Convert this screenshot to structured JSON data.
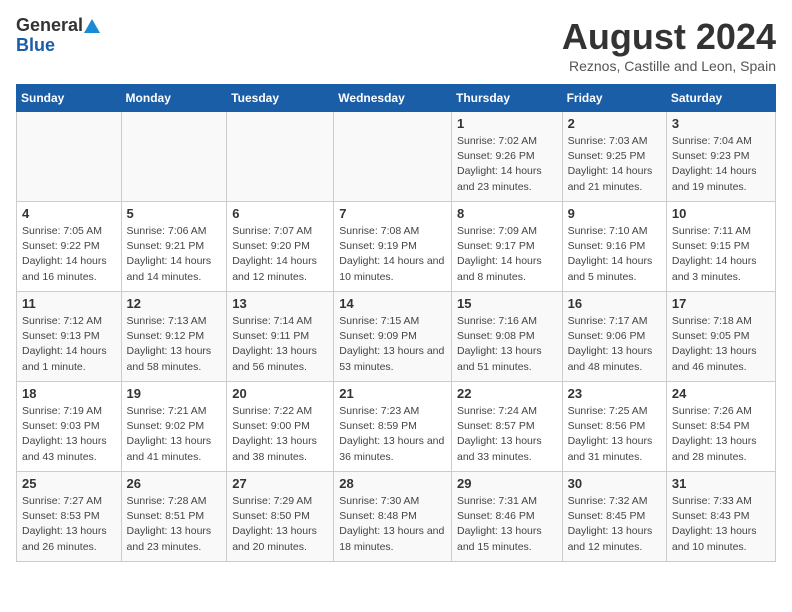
{
  "header": {
    "logo": {
      "line1": "General",
      "line2": "Blue"
    },
    "title": "August 2024",
    "location": "Reznos, Castille and Leon, Spain"
  },
  "days_of_week": [
    "Sunday",
    "Monday",
    "Tuesday",
    "Wednesday",
    "Thursday",
    "Friday",
    "Saturday"
  ],
  "weeks": [
    {
      "days": [
        {
          "number": "",
          "info": ""
        },
        {
          "number": "",
          "info": ""
        },
        {
          "number": "",
          "info": ""
        },
        {
          "number": "",
          "info": ""
        },
        {
          "number": "1",
          "info": "Sunrise: 7:02 AM\nSunset: 9:26 PM\nDaylight: 14 hours and 23 minutes."
        },
        {
          "number": "2",
          "info": "Sunrise: 7:03 AM\nSunset: 9:25 PM\nDaylight: 14 hours and 21 minutes."
        },
        {
          "number": "3",
          "info": "Sunrise: 7:04 AM\nSunset: 9:23 PM\nDaylight: 14 hours and 19 minutes."
        }
      ]
    },
    {
      "days": [
        {
          "number": "4",
          "info": "Sunrise: 7:05 AM\nSunset: 9:22 PM\nDaylight: 14 hours and 16 minutes."
        },
        {
          "number": "5",
          "info": "Sunrise: 7:06 AM\nSunset: 9:21 PM\nDaylight: 14 hours and 14 minutes."
        },
        {
          "number": "6",
          "info": "Sunrise: 7:07 AM\nSunset: 9:20 PM\nDaylight: 14 hours and 12 minutes."
        },
        {
          "number": "7",
          "info": "Sunrise: 7:08 AM\nSunset: 9:19 PM\nDaylight: 14 hours and 10 minutes."
        },
        {
          "number": "8",
          "info": "Sunrise: 7:09 AM\nSunset: 9:17 PM\nDaylight: 14 hours and 8 minutes."
        },
        {
          "number": "9",
          "info": "Sunrise: 7:10 AM\nSunset: 9:16 PM\nDaylight: 14 hours and 5 minutes."
        },
        {
          "number": "10",
          "info": "Sunrise: 7:11 AM\nSunset: 9:15 PM\nDaylight: 14 hours and 3 minutes."
        }
      ]
    },
    {
      "days": [
        {
          "number": "11",
          "info": "Sunrise: 7:12 AM\nSunset: 9:13 PM\nDaylight: 14 hours and 1 minute."
        },
        {
          "number": "12",
          "info": "Sunrise: 7:13 AM\nSunset: 9:12 PM\nDaylight: 13 hours and 58 minutes."
        },
        {
          "number": "13",
          "info": "Sunrise: 7:14 AM\nSunset: 9:11 PM\nDaylight: 13 hours and 56 minutes."
        },
        {
          "number": "14",
          "info": "Sunrise: 7:15 AM\nSunset: 9:09 PM\nDaylight: 13 hours and 53 minutes."
        },
        {
          "number": "15",
          "info": "Sunrise: 7:16 AM\nSunset: 9:08 PM\nDaylight: 13 hours and 51 minutes."
        },
        {
          "number": "16",
          "info": "Sunrise: 7:17 AM\nSunset: 9:06 PM\nDaylight: 13 hours and 48 minutes."
        },
        {
          "number": "17",
          "info": "Sunrise: 7:18 AM\nSunset: 9:05 PM\nDaylight: 13 hours and 46 minutes."
        }
      ]
    },
    {
      "days": [
        {
          "number": "18",
          "info": "Sunrise: 7:19 AM\nSunset: 9:03 PM\nDaylight: 13 hours and 43 minutes."
        },
        {
          "number": "19",
          "info": "Sunrise: 7:21 AM\nSunset: 9:02 PM\nDaylight: 13 hours and 41 minutes."
        },
        {
          "number": "20",
          "info": "Sunrise: 7:22 AM\nSunset: 9:00 PM\nDaylight: 13 hours and 38 minutes."
        },
        {
          "number": "21",
          "info": "Sunrise: 7:23 AM\nSunset: 8:59 PM\nDaylight: 13 hours and 36 minutes."
        },
        {
          "number": "22",
          "info": "Sunrise: 7:24 AM\nSunset: 8:57 PM\nDaylight: 13 hours and 33 minutes."
        },
        {
          "number": "23",
          "info": "Sunrise: 7:25 AM\nSunset: 8:56 PM\nDaylight: 13 hours and 31 minutes."
        },
        {
          "number": "24",
          "info": "Sunrise: 7:26 AM\nSunset: 8:54 PM\nDaylight: 13 hours and 28 minutes."
        }
      ]
    },
    {
      "days": [
        {
          "number": "25",
          "info": "Sunrise: 7:27 AM\nSunset: 8:53 PM\nDaylight: 13 hours and 26 minutes."
        },
        {
          "number": "26",
          "info": "Sunrise: 7:28 AM\nSunset: 8:51 PM\nDaylight: 13 hours and 23 minutes."
        },
        {
          "number": "27",
          "info": "Sunrise: 7:29 AM\nSunset: 8:50 PM\nDaylight: 13 hours and 20 minutes."
        },
        {
          "number": "28",
          "info": "Sunrise: 7:30 AM\nSunset: 8:48 PM\nDaylight: 13 hours and 18 minutes."
        },
        {
          "number": "29",
          "info": "Sunrise: 7:31 AM\nSunset: 8:46 PM\nDaylight: 13 hours and 15 minutes."
        },
        {
          "number": "30",
          "info": "Sunrise: 7:32 AM\nSunset: 8:45 PM\nDaylight: 13 hours and 12 minutes."
        },
        {
          "number": "31",
          "info": "Sunrise: 7:33 AM\nSunset: 8:43 PM\nDaylight: 13 hours and 10 minutes."
        }
      ]
    }
  ]
}
